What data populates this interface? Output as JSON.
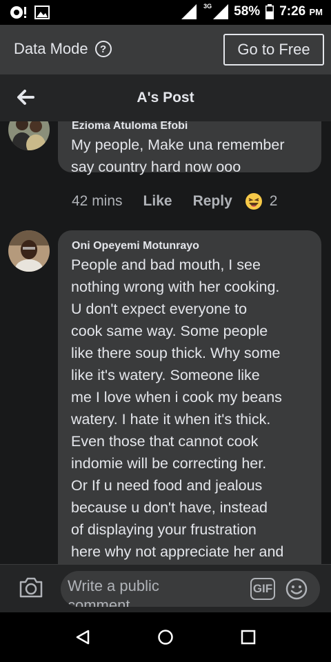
{
  "status_bar": {
    "network": "3G",
    "battery": "58%",
    "time": "7:26",
    "ampm": "PM"
  },
  "data_bar": {
    "label": "Data Mode",
    "help": "?",
    "go_free": "Go to Free"
  },
  "header": {
    "title": "A's Post"
  },
  "comments": [
    {
      "author": "Ezioma Atuloma Efobi",
      "lines": [
        "My people, Make una remember",
        "say country hard now ooo"
      ],
      "time": "42 mins",
      "like": "Like",
      "reply": "Reply",
      "reaction_count": "2"
    },
    {
      "author": "Oni Opeyemi Motunrayo",
      "lines": [
        "People and bad mouth, I see",
        "nothing wrong with her cooking.",
        "U don't expect everyone to",
        "cook same way. Some people",
        "like there soup thick. Why some",
        "like it's watery. Someone like",
        "me I love when i cook my beans",
        "watery. I hate it when it's thick.",
        "Even those that cannot cook",
        "indomie will be correcting her.",
        "Or If u need food and jealous",
        "because u don't have, instead",
        "of displaying your frustration",
        "here why not appreciate her and"
      ]
    }
  ],
  "composer": {
    "placeholder_line1": "Write a public",
    "placeholder_line2": "comment",
    "gif": "GIF"
  },
  "colors": {
    "bg": "#18191a",
    "bubble": "#3a3b3c",
    "text": "#e4e6eb",
    "meta": "#b0b3b8"
  }
}
